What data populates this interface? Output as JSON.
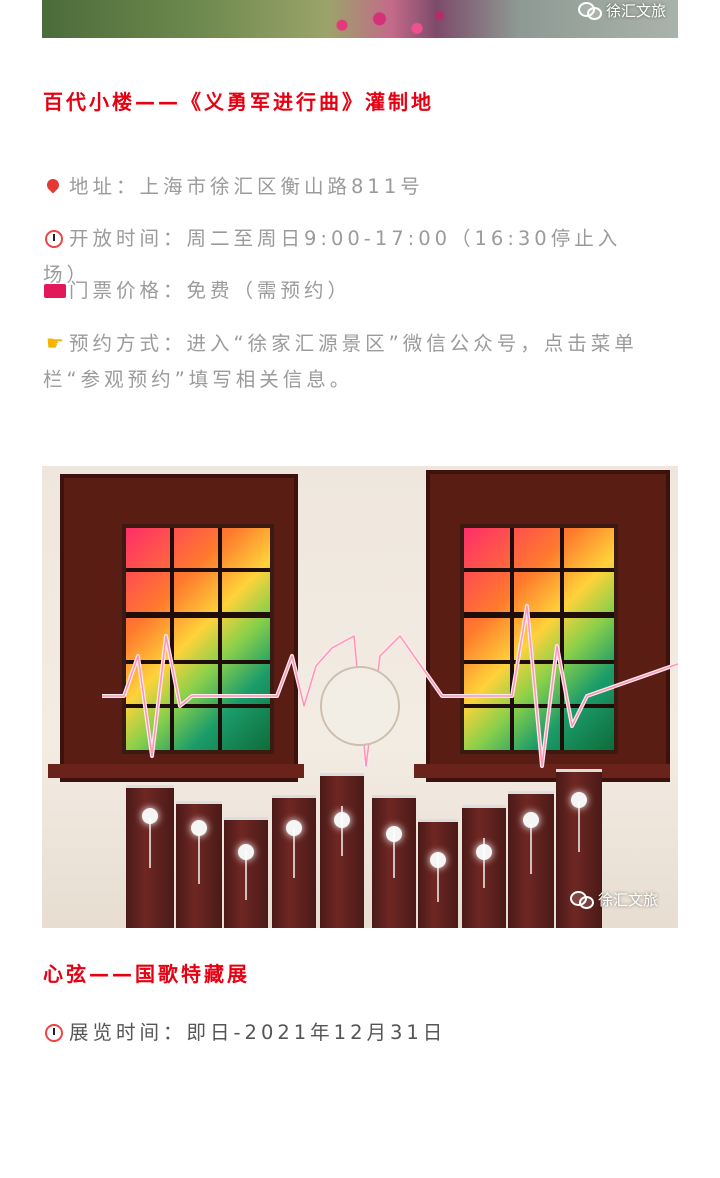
{
  "top_photo": {
    "watermark": "徐汇文旅"
  },
  "section1": {
    "title": "百代小楼——《义勇军进行曲》灌制地",
    "address": "地址：上海市徐汇区衡山路811号",
    "hours": "开放时间：周二至周日9:00-17:00（16:30停止入场）",
    "ticket": "门票价格：免费（需预约）",
    "booking": "预约方式：进入“徐家汇源景区”微信公众号，点击菜单栏“参观预约”填写相关信息。"
  },
  "main_photo": {
    "watermark": "徐汇文旅"
  },
  "section2": {
    "title": "心弦——国歌特藏展",
    "dates": "展览时间：即日-2021年12月31日"
  },
  "icons": {
    "address": "pin-icon",
    "hours": "alarm-clock-icon",
    "ticket": "ticket-icon",
    "booking": "pointing-hand-icon",
    "watermark": "wechat-icon"
  }
}
